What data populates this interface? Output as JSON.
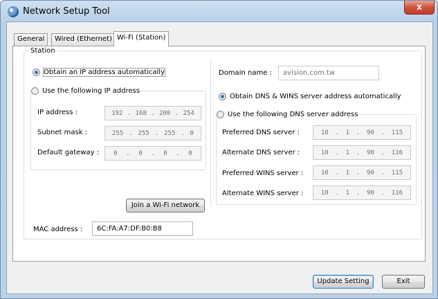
{
  "window": {
    "title": "Network Setup Tool",
    "close_label": "x"
  },
  "tabs": [
    {
      "label": "General",
      "active": false
    },
    {
      "label": "Wired (Ethernet)",
      "active": false
    },
    {
      "label": "Wi-Fi (Station)",
      "active": true
    }
  ],
  "station": {
    "legend": "Station",
    "ip_mode": {
      "auto_label": "Obtain an IP address automatically",
      "auto_selected": true,
      "manual_label": "Use the following IP address"
    },
    "ip_fields": [
      {
        "label": "IP address :",
        "octets": [
          "192",
          "168",
          "200",
          "254"
        ]
      },
      {
        "label": "Subnet mask :",
        "octets": [
          "255",
          "255",
          "255",
          "0"
        ]
      },
      {
        "label": "Default gateway :",
        "octets": [
          "0",
          "0",
          "0",
          "0"
        ]
      }
    ],
    "join_button_label": "Join a Wi-Fi network",
    "domain": {
      "label": "Domain name :",
      "value": "avision.com.tw"
    },
    "dns_mode": {
      "auto_label": "Obtain DNS & WINS server address automatically",
      "auto_selected": true,
      "manual_label": "Use the following DNS server address"
    },
    "dns_fields": [
      {
        "label": "Preferred DNS server :",
        "octets": [
          "10",
          "1",
          "90",
          "115"
        ]
      },
      {
        "label": "Alternate DNS server :",
        "octets": [
          "10",
          "1",
          "90",
          "116"
        ]
      },
      {
        "label": "Preferred WINS server :",
        "octets": [
          "10",
          "1",
          "90",
          "115"
        ]
      },
      {
        "label": "Alternate WINS server :",
        "octets": [
          "10",
          "1",
          "90",
          "116"
        ]
      }
    ],
    "mac": {
      "label": "MAC address :",
      "value": "6C:FA:A7:DF:B0:B8"
    }
  },
  "footer": {
    "update_label": "Update Setting",
    "exit_label": "Exit"
  }
}
